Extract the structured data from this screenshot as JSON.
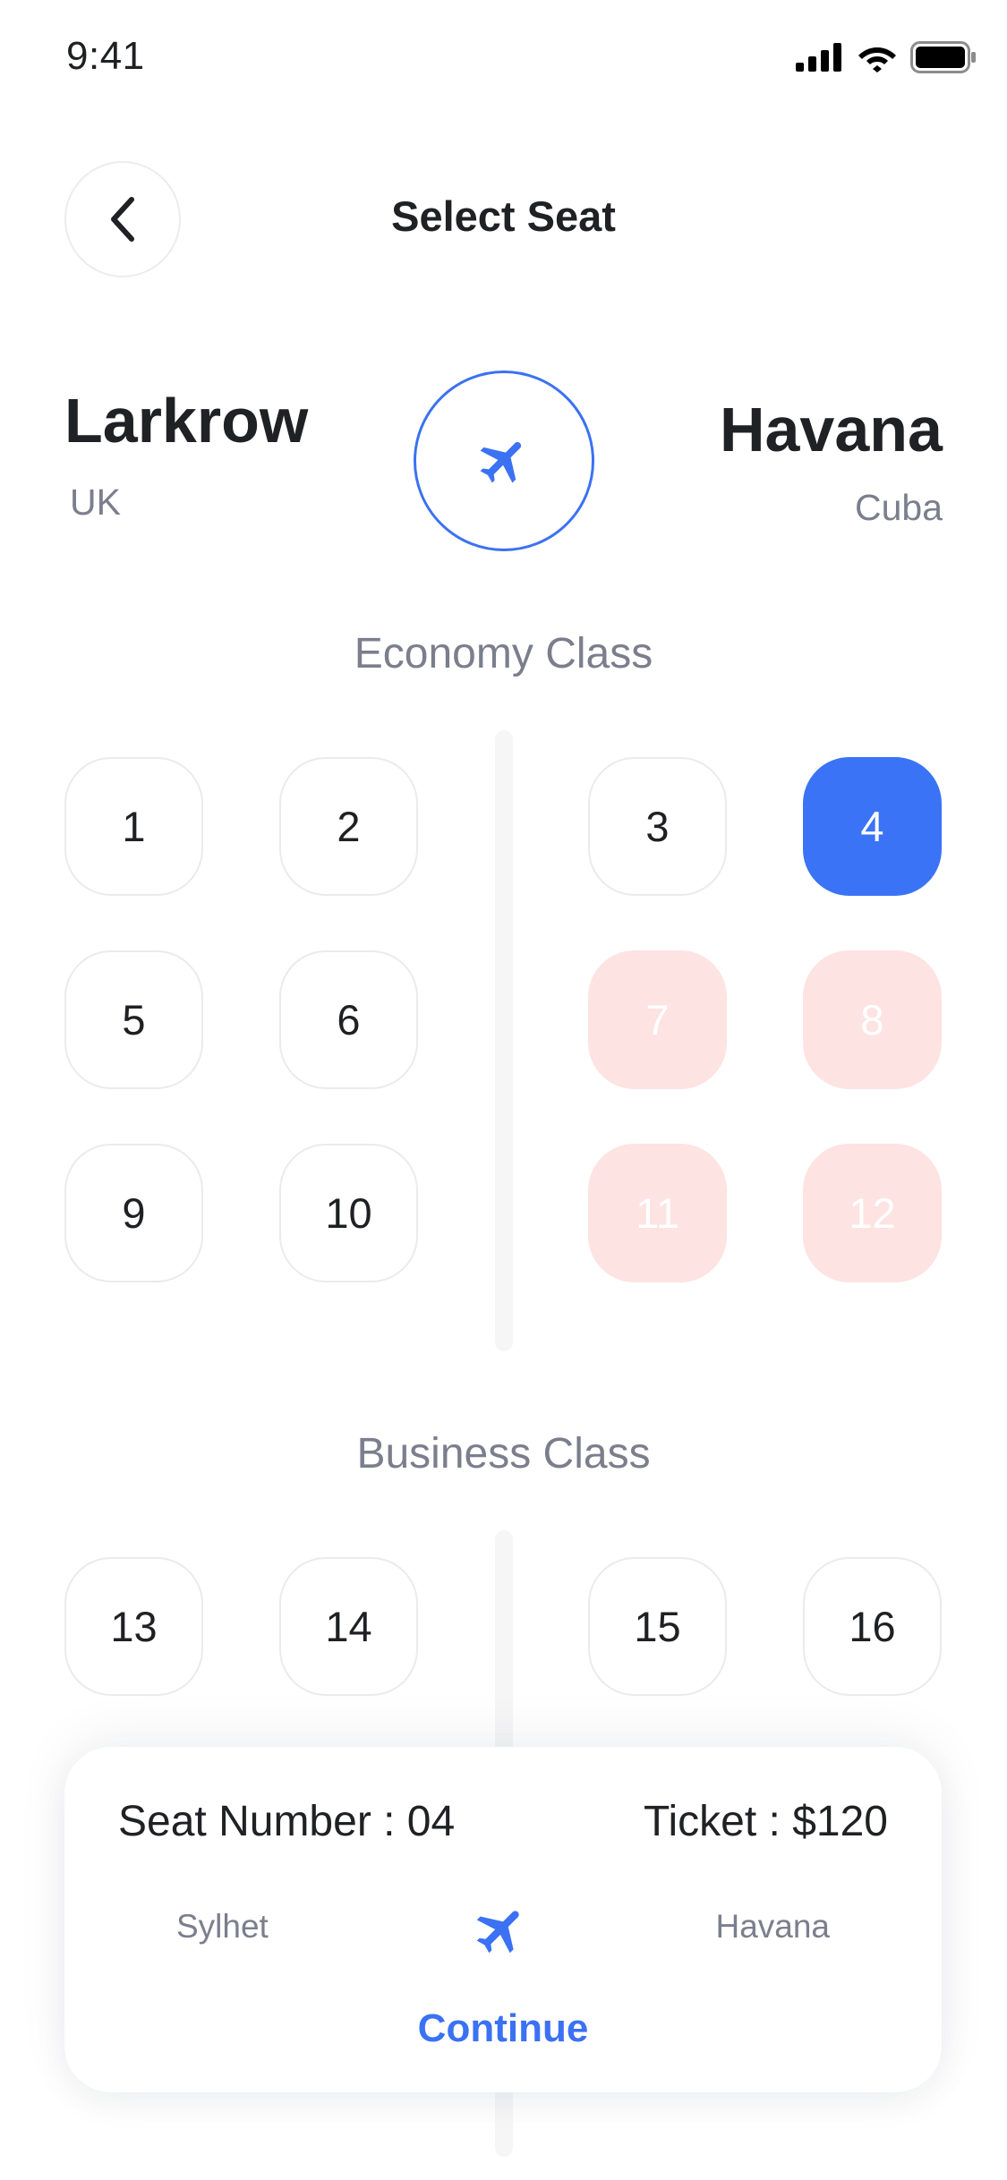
{
  "status_bar": {
    "time": "9:41"
  },
  "header": {
    "title": "Select Seat"
  },
  "route": {
    "from": {
      "city": "Larkrow",
      "country": "UK"
    },
    "to": {
      "city": "Havana",
      "country": "Cuba"
    }
  },
  "economy": {
    "label": "Economy Class",
    "seats": [
      {
        "number": "1",
        "state": "available"
      },
      {
        "number": "2",
        "state": "available"
      },
      {
        "number": "3",
        "state": "available"
      },
      {
        "number": "4",
        "state": "selected"
      },
      {
        "number": "5",
        "state": "available"
      },
      {
        "number": "6",
        "state": "available"
      },
      {
        "number": "7",
        "state": "booked"
      },
      {
        "number": "8",
        "state": "booked"
      },
      {
        "number": "9",
        "state": "available"
      },
      {
        "number": "10",
        "state": "available"
      },
      {
        "number": "11",
        "state": "booked"
      },
      {
        "number": "12",
        "state": "booked"
      }
    ]
  },
  "business": {
    "label": "Business Class",
    "seats": [
      {
        "number": "13",
        "state": "available"
      },
      {
        "number": "14",
        "state": "available"
      },
      {
        "number": "15",
        "state": "available"
      },
      {
        "number": "16",
        "state": "available"
      }
    ]
  },
  "summary": {
    "seat_number": "Seat Number : 04",
    "ticket": "Ticket : $120",
    "from": "Sylhet",
    "to": "Havana",
    "continue_label": "Continue"
  },
  "colors": {
    "accent": "#3b71f3",
    "booked": "#fde3e2",
    "muted_text": "#7b7e8c"
  }
}
